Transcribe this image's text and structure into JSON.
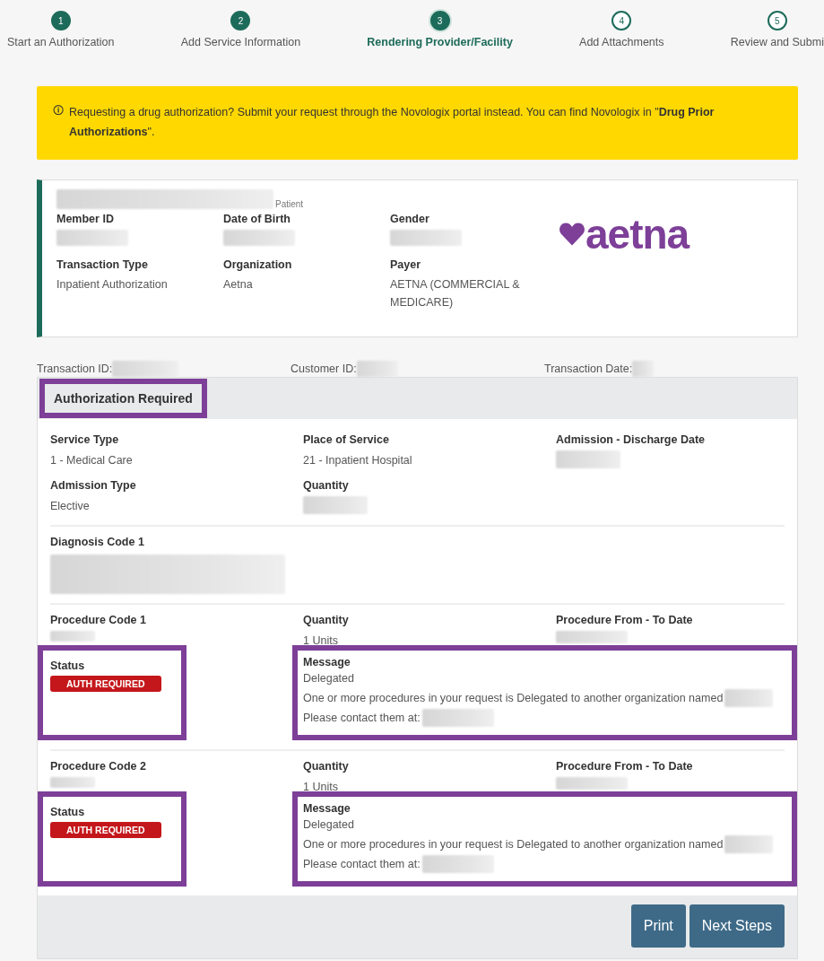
{
  "steps": [
    {
      "number": "1",
      "label": "Start an Authorization",
      "completed": true,
      "selected": false
    },
    {
      "number": "2",
      "label": "Add Service Information",
      "completed": true,
      "selected": false
    },
    {
      "number": "3",
      "label": "Rendering Provider/Facility",
      "completed": true,
      "selected": true
    },
    {
      "number": "4",
      "label": "Add Attachments",
      "completed": false,
      "selected": false
    },
    {
      "number": "5",
      "label": "Review and Submi",
      "completed": false,
      "selected": false
    }
  ],
  "alert": {
    "icon": "🛈",
    "text": "Requesting a drug authorization? Submit your request through the Novologix portal instead. You can find Novologix in \"**Drug Prior Authorizations**\"."
  },
  "patient_card": {
    "name_caption": "Patient",
    "logo": "aetna",
    "fields": [
      {
        "label": "Member ID",
        "redacted": true
      },
      {
        "label": "Date of Birth",
        "redacted": true
      },
      {
        "label": "Gender",
        "redacted": true
      },
      {
        "label": "Transaction Type",
        "value": "Inpatient Authorization",
        "redacted": false
      },
      {
        "label": "Organization",
        "value": "Aetna",
        "redacted": false
      },
      {
        "label": "Payer",
        "value": "AETNA (COMMERCIAL & MEDICARE)",
        "redacted": false
      }
    ]
  },
  "transaction_info": [
    {
      "label": "Transaction ID:"
    },
    {
      "label": "Customer ID:"
    },
    {
      "label": "Transaction Date:"
    }
  ],
  "section": {
    "title": "Authorization Required",
    "highlighted": true,
    "fields": [
      {
        "label": "Service Type",
        "value": "1 - Medical Care",
        "redacted": false
      },
      {
        "label": "Place of Service",
        "value": "21 - Inpatient Hospital",
        "redacted": false
      },
      {
        "label": "Admission - Discharge Date",
        "redacted": true
      },
      {
        "label": "Admission Type",
        "value": "Elective",
        "redacted": false
      },
      {
        "label": "Quantity",
        "redacted": true
      }
    ],
    "diagnosis": {
      "label": "Diagnosis Code 1"
    },
    "procedures": [
      {
        "code_label": "Procedure Code 1",
        "quantity_label": "Quantity",
        "quantity": "1 Units",
        "date_label": "Procedure From - To Date",
        "status_label": "Status",
        "status": "AUTH REQUIRED",
        "status_highlighted": true,
        "message_label": "Message",
        "message_highlighted": true,
        "message_title": "Delegated",
        "message_line": "One or more procedures in your request is Delegated to another organization named",
        "contact_line": "Please contact them at:"
      },
      {
        "code_label": "Procedure Code 2",
        "quantity_label": "Quantity",
        "quantity": "1 Units",
        "date_label": "Procedure From - To Date",
        "status_label": "Status",
        "status": "AUTH REQUIRED",
        "status_highlighted": true,
        "message_label": "Message",
        "message_highlighted": true,
        "message_title": "Delegated",
        "message_line": "One or more procedures in your request is Delegated to another organization named",
        "contact_line": "Please contact them at:"
      }
    ]
  },
  "buttons": [
    "Print",
    "Next Steps"
  ]
}
